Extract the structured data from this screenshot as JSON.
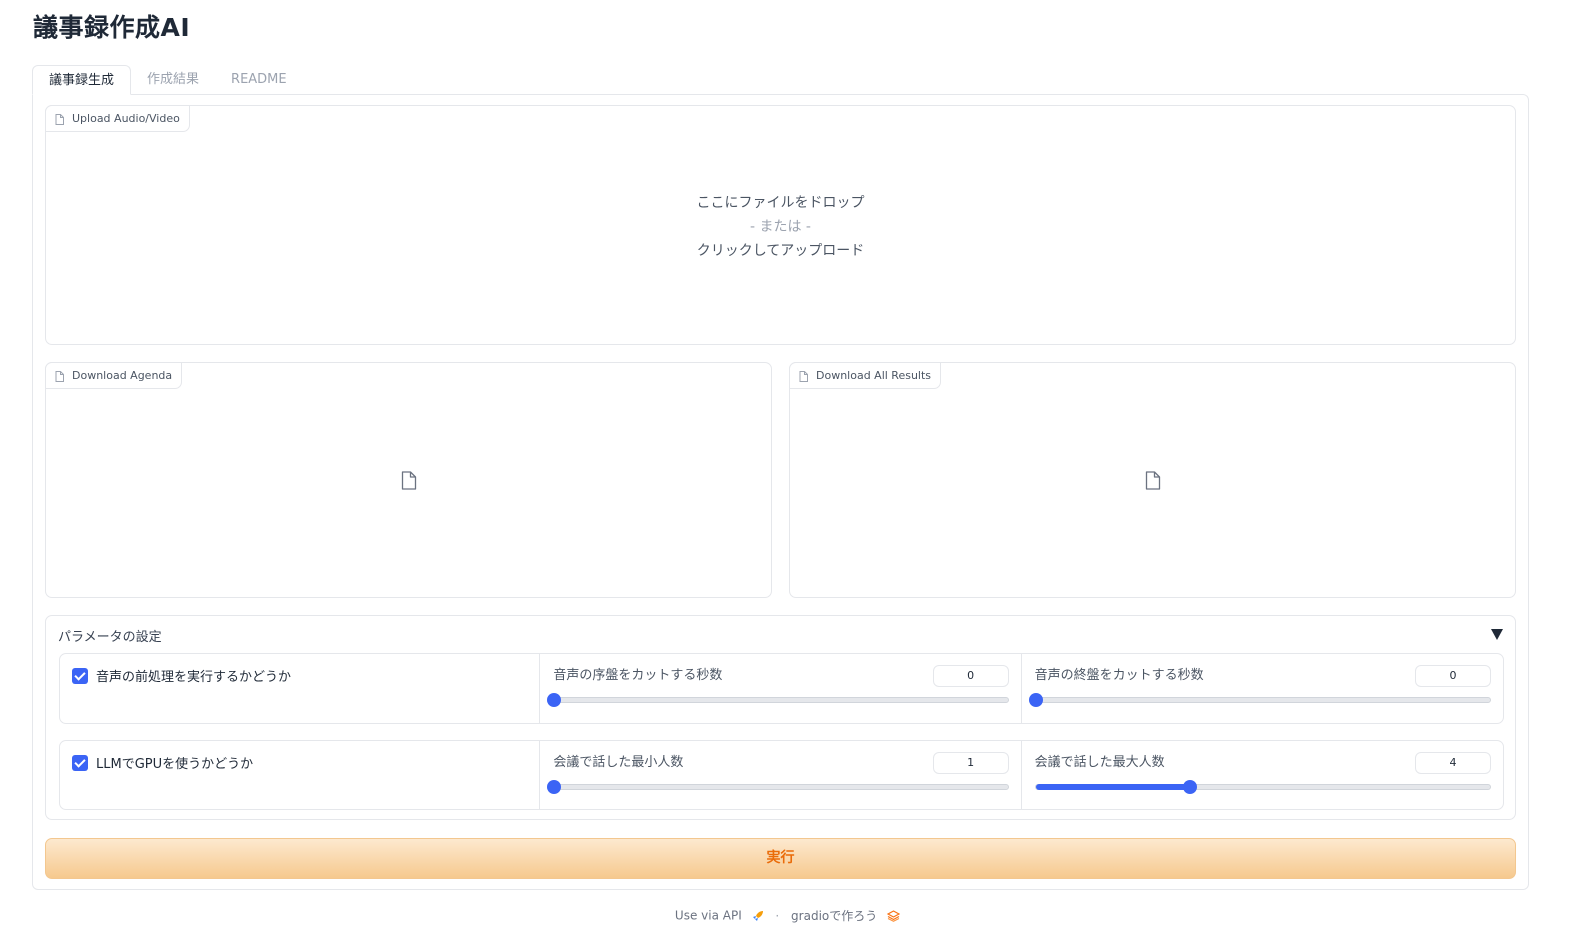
{
  "app": {
    "title": "議事録作成AI"
  },
  "tabs": [
    {
      "label": "議事録生成",
      "active": true
    },
    {
      "label": "作成結果",
      "active": false
    },
    {
      "label": "README",
      "active": false
    }
  ],
  "upload": {
    "label": "Upload Audio/Video",
    "drop_text": "ここにファイルをドロップ",
    "or_text": "- または -",
    "click_text": "クリックしてアップロード"
  },
  "downloads": {
    "agenda_label": "Download Agenda",
    "results_label": "Download All Results"
  },
  "params": {
    "title": "パラメータの設定",
    "preprocess_label": "音声の前処理を実行するかどうか",
    "preprocess_checked": true,
    "gpu_label": "LLMでGPUを使うかどうか",
    "gpu_checked": true,
    "cut_start": {
      "label": "音声の序盤をカットする秒数",
      "value": "0",
      "fraction": 0.0
    },
    "cut_end": {
      "label": "音声の終盤をカットする秒数",
      "value": "0",
      "fraction": 0.0
    },
    "min_speakers": {
      "label": "会議で話した最小人数",
      "value": "1",
      "fraction": 0.0
    },
    "max_speakers": {
      "label": "会議で話した最大人数",
      "value": "4",
      "fraction": 0.34
    }
  },
  "run_button": {
    "label": "実行"
  },
  "footer": {
    "api_text": "Use via API",
    "separator": "·",
    "built_with": "gradioで作ろう"
  },
  "colors": {
    "accent": "#3b64f5",
    "button_text": "#ea6c0a"
  }
}
